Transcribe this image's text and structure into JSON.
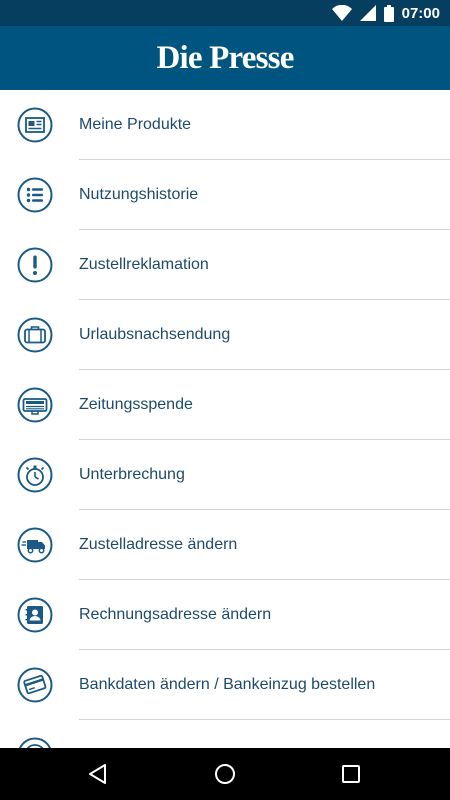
{
  "statusbar": {
    "time": "07:00"
  },
  "header": {
    "title": "Die Presse"
  },
  "menu": [
    {
      "label": "Meine Produkte",
      "icon": "newspaper-icon"
    },
    {
      "label": "Nutzungshistorie",
      "icon": "list-icon"
    },
    {
      "label": "Zustellreklamation",
      "icon": "exclamation-icon"
    },
    {
      "label": "Urlaubsnachsendung",
      "icon": "suitcase-icon"
    },
    {
      "label": "Zeitungsspende",
      "icon": "donation-icon"
    },
    {
      "label": "Unterbrechung",
      "icon": "stopwatch-icon"
    },
    {
      "label": "Zustelladresse ändern",
      "icon": "delivery-truck-icon"
    },
    {
      "label": "Rechnungsadresse ändern",
      "icon": "address-book-icon"
    },
    {
      "label": "Bankdaten ändern / Bankeinzug bestellen",
      "icon": "credit-card-icon"
    },
    {
      "label": "",
      "icon": "circle-icon"
    }
  ],
  "colors": {
    "primary": "#005580",
    "statusbar": "#053e5f",
    "text": "#1f4b6b",
    "icon": "#1a5a84"
  }
}
